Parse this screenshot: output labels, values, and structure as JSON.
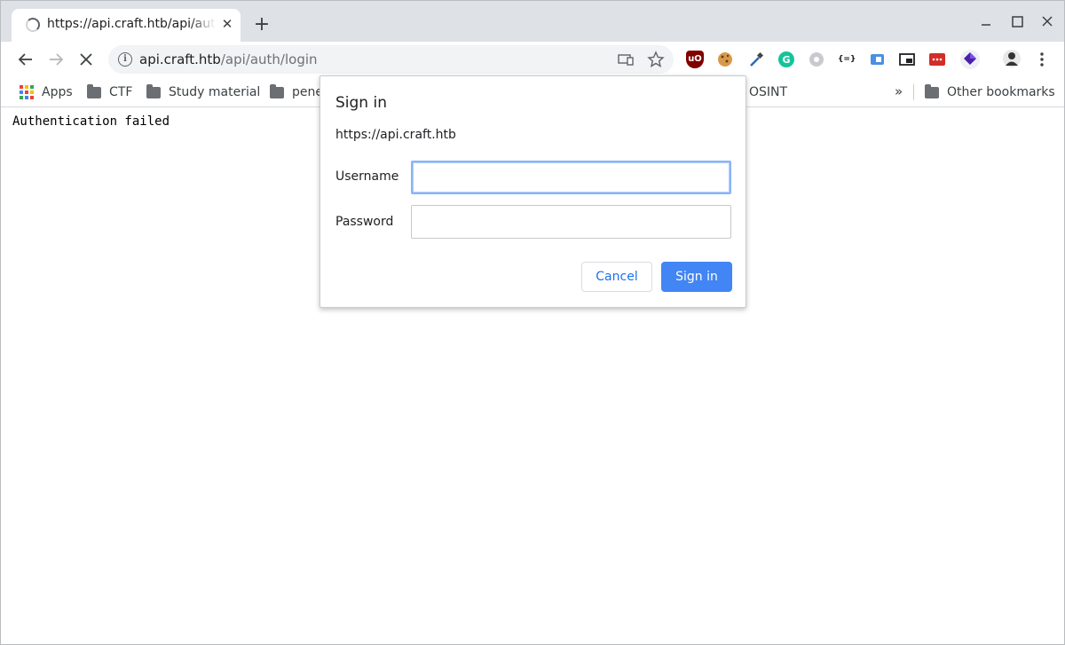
{
  "browser": {
    "tab": {
      "title": "https://api.craft.htb/api/auth/login",
      "close_glyph": "✕"
    },
    "new_tab_glyph": "+",
    "window_controls": {
      "minimize": "—",
      "maximize": "☐",
      "close": "✕"
    },
    "url": {
      "host": "api.craft.htb",
      "path": "/api/auth/login"
    },
    "bookmarks": [
      "Apps",
      "CTF",
      "Study material",
      "pene",
      "OSINT"
    ],
    "bookmarks_overflow": "»",
    "other_bookmarks": "Other bookmarks",
    "extension_icons": [
      "ublock-origin-icon",
      "cookie-icon",
      "color-picker-icon",
      "grammarly-icon",
      "proxy-icon",
      "json-viewer-icon",
      "wappalyzer-icon",
      "picture-in-picture-icon",
      "lastpass-icon",
      "extension-diamond-icon",
      "profile-avatar"
    ],
    "accent_colors": {
      "apps_grid": [
        "#ea4335",
        "#fbbc05",
        "#34a853",
        "#4285f4"
      ]
    }
  },
  "page": {
    "body_text": "Authentication failed"
  },
  "dialog": {
    "title": "Sign in",
    "origin": "https://api.craft.htb",
    "username_label": "Username",
    "username_value": "",
    "password_label": "Password",
    "password_value": "",
    "cancel_label": "Cancel",
    "signin_label": "Sign in",
    "primary_color": "#4285f4"
  }
}
